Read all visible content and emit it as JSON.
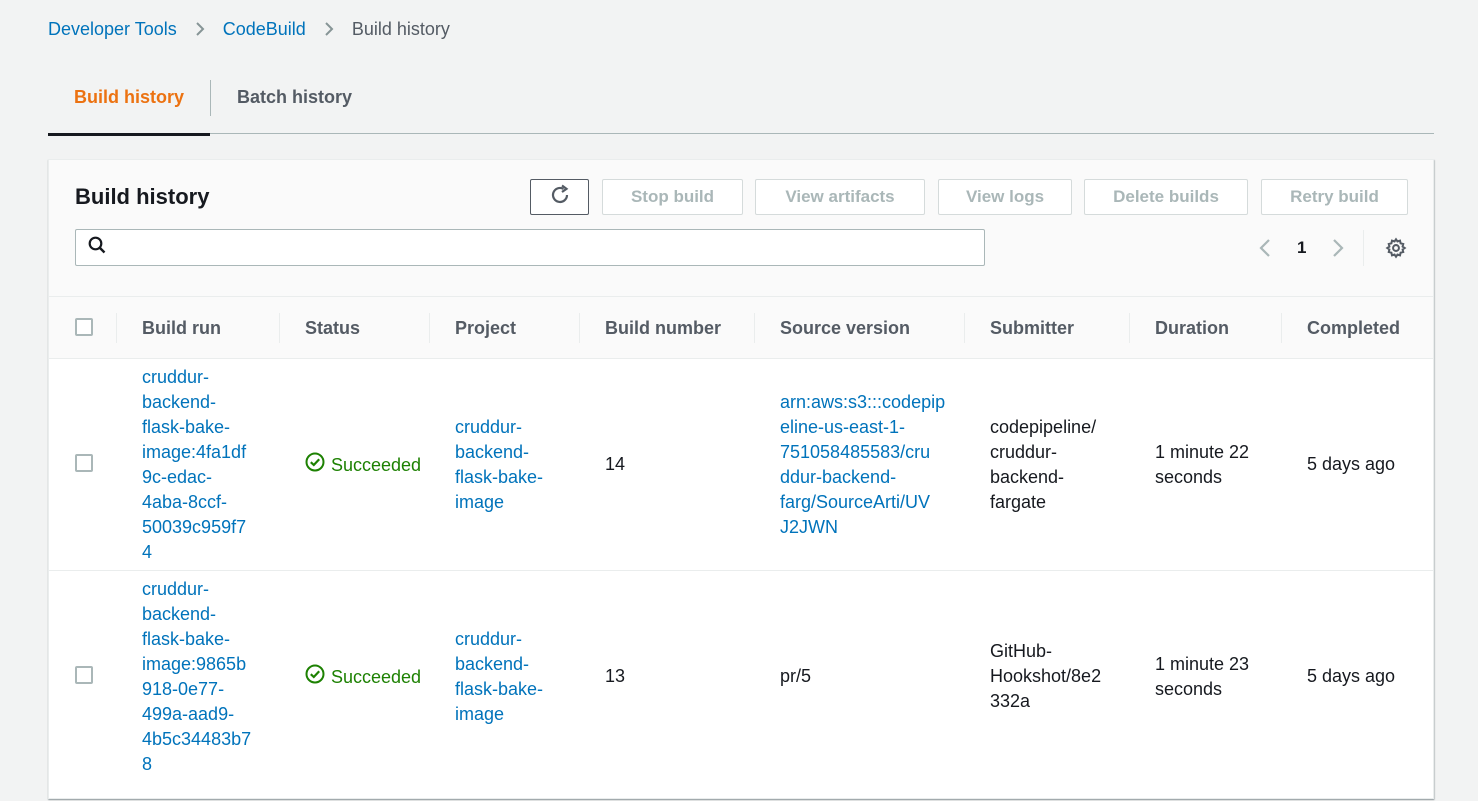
{
  "breadcrumb": {
    "items": [
      "Developer Tools",
      "CodeBuild"
    ],
    "current": "Build history"
  },
  "tabs": [
    {
      "label": "Build history",
      "active": true
    },
    {
      "label": "Batch history",
      "active": false
    }
  ],
  "panel": {
    "title": "Build history",
    "buttons": {
      "stop": "Stop build",
      "artifacts": "View artifacts",
      "logs": "View logs",
      "delete": "Delete builds",
      "retry": "Retry build"
    },
    "search": {
      "value": "",
      "placeholder": ""
    },
    "page": "1"
  },
  "table": {
    "columns": [
      "Build run",
      "Status",
      "Project",
      "Build number",
      "Source version",
      "Submitter",
      "Duration",
      "Completed"
    ],
    "rows": [
      {
        "build_run": "cruddur-backend-flask-bake-image:4fa1df9c-edac-4aba-8ccf-50039c959f74",
        "build_run_lines": [
          "cruddur-",
          "backend-",
          "flask-bake-",
          "image:4fa1df",
          "9c-edac-",
          "4aba-8ccf-",
          "50039c959f7",
          "4"
        ],
        "status": "Succeeded",
        "project_lines": [
          "cruddur-",
          "backend-",
          "flask-bake-",
          "image"
        ],
        "build_number": "14",
        "source_lines": [
          "arn:aws:s3:::codepip",
          "eline-us-east-1-",
          "751058485583/cru",
          "ddur-backend-",
          "farg/SourceArti/UV",
          "J2JWN"
        ],
        "source_is_link": true,
        "submitter_lines": [
          "codepipeline/",
          "cruddur-",
          "backend-",
          "fargate"
        ],
        "duration_lines": [
          "1 minute 22",
          "seconds"
        ],
        "completed": "5 days ago"
      },
      {
        "build_run": "cruddur-backend-flask-bake-image:9865b918-0e77-499a-aad9-4b5c34483b78",
        "build_run_lines": [
          "cruddur-",
          "backend-",
          "flask-bake-",
          "image:9865b",
          "918-0e77-",
          "499a-aad9-",
          "4b5c34483b7",
          "8"
        ],
        "status": "Succeeded",
        "project_lines": [
          "cruddur-",
          "backend-",
          "flask-bake-",
          "image"
        ],
        "build_number": "13",
        "source_lines": [
          "pr/5"
        ],
        "source_is_link": false,
        "submitter_lines": [
          "GitHub-",
          "Hookshot/8e2",
          "332a"
        ],
        "duration_lines": [
          "1 minute 23",
          "seconds"
        ],
        "completed": "5 days ago"
      }
    ]
  },
  "colors": {
    "link": "#0073bb",
    "active_tab": "#ec7211",
    "success": "#1d8102",
    "disabled": "#aab7b8"
  }
}
